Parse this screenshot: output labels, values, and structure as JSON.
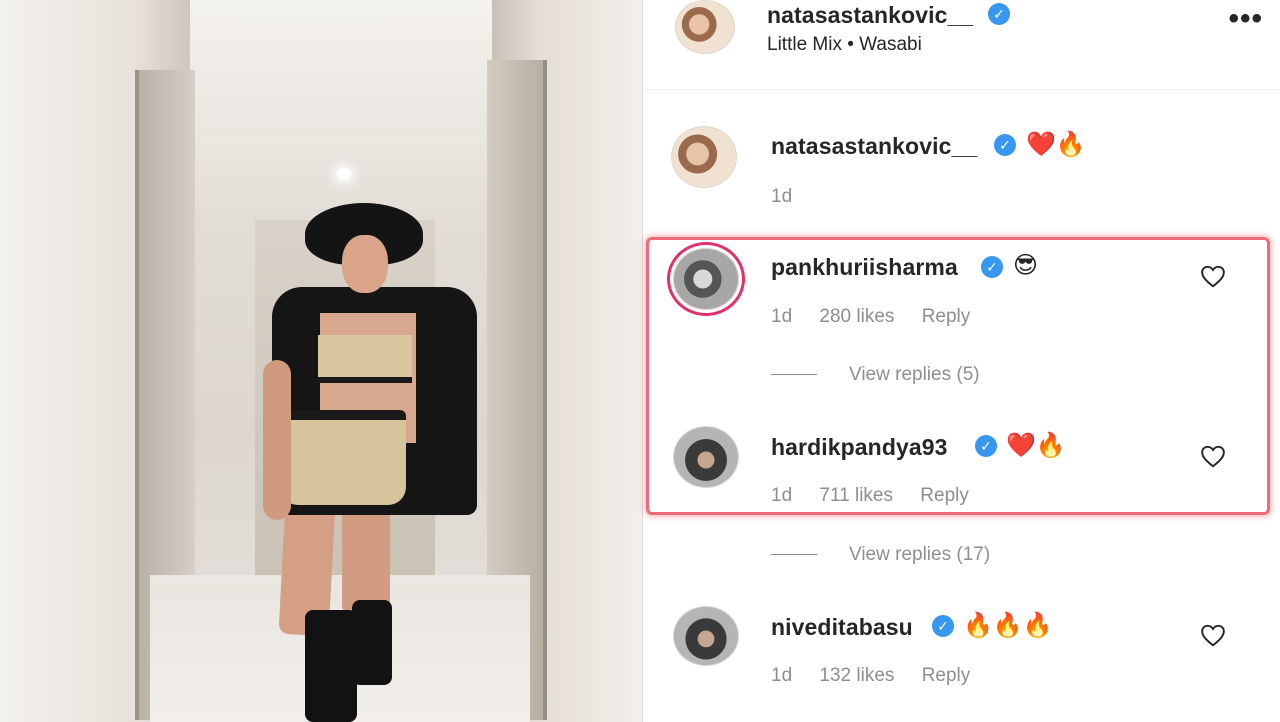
{
  "post": {
    "author": "natasastankovic__",
    "audio": "Little Mix • Wasabi"
  },
  "caption": {
    "username": "natasastankovic__",
    "text_emoji": "❤️🔥",
    "time": "1d"
  },
  "comments": [
    {
      "username": "pankhuriisharma",
      "verified": true,
      "text_emoji": "😎",
      "time": "1d",
      "likes": "280 likes",
      "reply_label": "Reply",
      "view_replies": "View replies (5)",
      "highlighted": true
    },
    {
      "username": "hardikpandya93",
      "verified": true,
      "text_emoji": "❤️🔥",
      "time": "1d",
      "likes": "711 likes",
      "reply_label": "Reply",
      "view_replies": "View replies (17)",
      "highlighted": true
    },
    {
      "username": "niveditabasu",
      "verified": true,
      "text_emoji": "🔥🔥🔥",
      "time": "1d",
      "likes": "132 likes",
      "reply_label": "Reply"
    }
  ],
  "icons": {
    "verified": "verified-badge-icon",
    "more": "more-options-icon",
    "like": "heart-outline-icon"
  },
  "colors": {
    "verified_blue": "#3897f0",
    "highlight_border": "#ef6a7a",
    "muted_text": "#8e8e8e",
    "story_ring": "#e1306c"
  }
}
